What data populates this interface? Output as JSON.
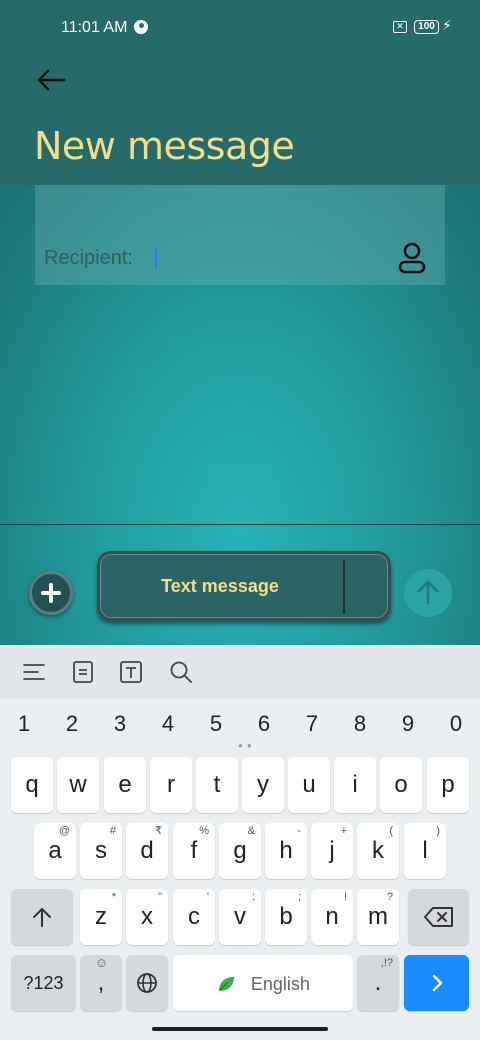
{
  "status": {
    "time": "11:01 AM",
    "battery": "100",
    "sim": "✕"
  },
  "header": {
    "title": "New message"
  },
  "recipient": {
    "label": "Recipient:"
  },
  "composer": {
    "placeholder": "Text message"
  },
  "keyboard": {
    "numbers": [
      "1",
      "2",
      "3",
      "4",
      "5",
      "6",
      "7",
      "8",
      "9",
      "0"
    ],
    "row1": [
      "q",
      "w",
      "e",
      "r",
      "t",
      "y",
      "u",
      "i",
      "o",
      "p"
    ],
    "row2": [
      {
        "key": "a",
        "sub": "@"
      },
      {
        "key": "s",
        "sub": "#"
      },
      {
        "key": "d",
        "sub": "₹"
      },
      {
        "key": "f",
        "sub": "%"
      },
      {
        "key": "g",
        "sub": "&"
      },
      {
        "key": "h",
        "sub": "-"
      },
      {
        "key": "j",
        "sub": "+"
      },
      {
        "key": "k",
        "sub": "("
      },
      {
        "key": "l",
        "sub": ")"
      }
    ],
    "row3": [
      {
        "key": "z",
        "sub": "*"
      },
      {
        "key": "x",
        "sub": "\""
      },
      {
        "key": "c",
        "sub": "'"
      },
      {
        "key": "v",
        "sub": ":"
      },
      {
        "key": "b",
        "sub": ";"
      },
      {
        "key": "n",
        "sub": "!"
      },
      {
        "key": "m",
        "sub": "?"
      }
    ],
    "symbols_label": "?123",
    "comma": ",",
    "space_label": "English",
    "period": ".",
    "period_sub": ",!?"
  },
  "colors": {
    "header_bg": "#266a6a",
    "title": "#f5dd8a",
    "enter_key": "#1a8cff"
  }
}
